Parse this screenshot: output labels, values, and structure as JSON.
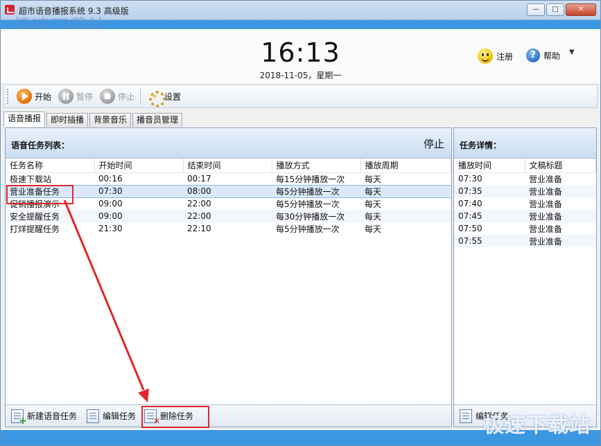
{
  "window": {
    "title": "超市语音播报系统 9.3 高级版",
    "watermark_top": "极速下载站",
    "watermark_bottom": "极速下载站",
    "controls": [
      "—",
      "□",
      "✕"
    ]
  },
  "header": {
    "clock": "16:13",
    "date": "2018-11-05，星期一",
    "register_label": "注册",
    "help_label": "帮助"
  },
  "toolbar": {
    "start": "开始",
    "pause": "暂停",
    "stop": "停止",
    "settings": "设置"
  },
  "tabs": [
    "语音播报",
    "即时插播",
    "背景音乐",
    "播音员管理"
  ],
  "task_panel": {
    "title": "语音任务列表：",
    "stop_text": "停止",
    "columns": [
      "任务名称",
      "开始时间",
      "结束时间",
      "播放方式",
      "播放周期"
    ],
    "rows": [
      {
        "name": "极速下载站",
        "start": "00:16",
        "end": "00:17",
        "mode": "每15分钟播放一次",
        "cycle": "每天"
      },
      {
        "name": "营业准备任务",
        "start": "07:30",
        "end": "08:00",
        "mode": "每5分钟播放一次",
        "cycle": "每天"
      },
      {
        "name": "促销播报演示",
        "start": "09:00",
        "end": "22:00",
        "mode": "每5分钟播放一次",
        "cycle": "每天"
      },
      {
        "name": "安全提醒任务",
        "start": "09:00",
        "end": "22:00",
        "mode": "每30分钟播放一次",
        "cycle": "每天"
      },
      {
        "name": "打烊提醒任务",
        "start": "21:30",
        "end": "22:10",
        "mode": "每5分钟播放一次",
        "cycle": "每天"
      }
    ],
    "footer": {
      "new_task": "新建语音任务",
      "edit_task": "编辑任务",
      "delete_task": "删除任务"
    }
  },
  "detail_panel": {
    "title": "任务详情：",
    "columns": [
      "播放时间",
      "文稿标题"
    ],
    "rows": [
      {
        "time": "07:30",
        "doc": "营业准备"
      },
      {
        "time": "07:35",
        "doc": "营业准备"
      },
      {
        "time": "07:40",
        "doc": "营业准备"
      },
      {
        "time": "07:45",
        "doc": "营业准备"
      },
      {
        "time": "07:50",
        "doc": "营业准备"
      },
      {
        "time": "07:55",
        "doc": "营业准备"
      }
    ],
    "footer": {
      "edit_task": "编辑任务"
    }
  },
  "colors": {
    "accent_blue": "#3c97e3",
    "annotation_red": "#e0262c",
    "selected_row": "#dbe9fb"
  }
}
